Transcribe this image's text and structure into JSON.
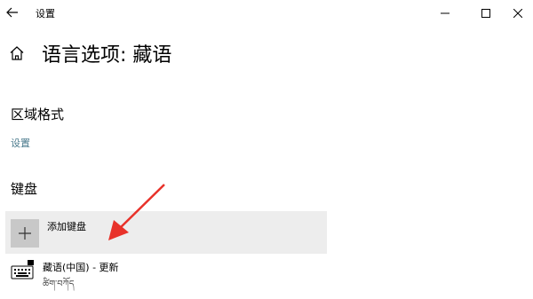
{
  "window": {
    "title": "设置"
  },
  "page": {
    "title": "语言选项: 藏语"
  },
  "region": {
    "heading": "区域格式",
    "settings_link": "设置"
  },
  "keyboard": {
    "heading": "键盘",
    "add_label": "添加键盘",
    "installed_name": "藏语(中国) - 更新",
    "installed_sub": "ཚིག་བཀོད"
  },
  "colors": {
    "link": "#4a7a8c",
    "add_row_bg": "#ededed",
    "arrow": "#e8322a"
  }
}
